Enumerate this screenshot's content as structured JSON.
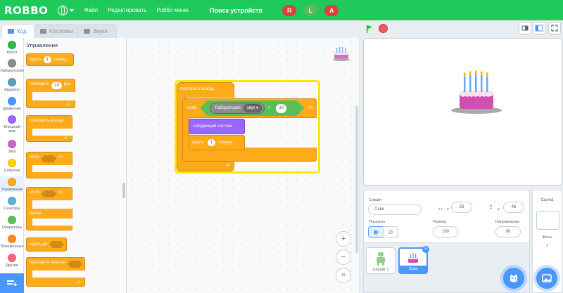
{
  "topbar": {
    "logo": "ROBBO",
    "menu": [
      "Файл",
      "Редактировать",
      "Роббо меню"
    ],
    "search": "Поиск устройств",
    "robot_buttons": [
      {
        "label": "R",
        "color": "#e23d3d"
      },
      {
        "label": "L",
        "color": "#5cb85c"
      },
      {
        "label": "A",
        "color": "#e23d3d"
      }
    ]
  },
  "tabs": {
    "code": "Код",
    "costumes": "Костюмы",
    "sounds": "Звуки"
  },
  "categories": [
    {
      "label": "Робот",
      "color": "#2eb84a"
    },
    {
      "label": "Лаборатория",
      "color": "#8c8c8c"
    },
    {
      "label": "Ардуино",
      "color": "#5aa0b8"
    },
    {
      "label": "Движение",
      "color": "#4c97ff"
    },
    {
      "label": "Внешний вид",
      "color": "#9966ff"
    },
    {
      "label": "Звук",
      "color": "#cf63cf"
    },
    {
      "label": "События",
      "color": "#ffd500"
    },
    {
      "label": "Управление",
      "color": "#ffab19"
    },
    {
      "label": "Сенсоры",
      "color": "#5cb1d6"
    },
    {
      "label": "Операторы",
      "color": "#59c059"
    },
    {
      "label": "Переменные",
      "color": "#ff8c1a"
    },
    {
      "label": "Другие",
      "color": "#ff6680"
    }
  ],
  "palette": {
    "title": "Управление",
    "wait": {
      "pre": "ждать",
      "value": "1",
      "post": "секунд"
    },
    "repeat": {
      "pre": "повторить",
      "value": "10",
      "post": "раз"
    },
    "forever": "повторить всегда",
    "if_then": {
      "pre": "если",
      "post": "то"
    },
    "if_else": {
      "pre": "если",
      "post": "то",
      "else": "иначе"
    },
    "wait_until": "ждать до",
    "repeat_until": "повторить пока не"
  },
  "script": {
    "forever": "повторить всегда",
    "if": "если",
    "then": "то",
    "sensor": "Лаборатория",
    "sensor_dropdown": "звук",
    "op": ">",
    "threshold": "30",
    "next_costume": "следующий костюм",
    "wait": "ждать",
    "wait_value": "1",
    "wait_unit": "секунд"
  },
  "zoom_controls": [
    "+",
    "−",
    "="
  ],
  "sprite_info": {
    "sprite_label": "Спрайт",
    "sprite_name": "Сake",
    "x_label": "x",
    "x_value": "33",
    "y_label": "y",
    "y_value": "46",
    "show_label": "Показать",
    "size_label": "Размер",
    "size_value": "100",
    "direction_label": "Направление",
    "direction_value": "90"
  },
  "sprites": [
    {
      "name": "Спрайт 1",
      "selected": false
    },
    {
      "name": "Сake",
      "selected": true
    }
  ],
  "scene": {
    "title": "Сцена",
    "backdrops_label": "Фоны",
    "backdrops_count": "1"
  }
}
